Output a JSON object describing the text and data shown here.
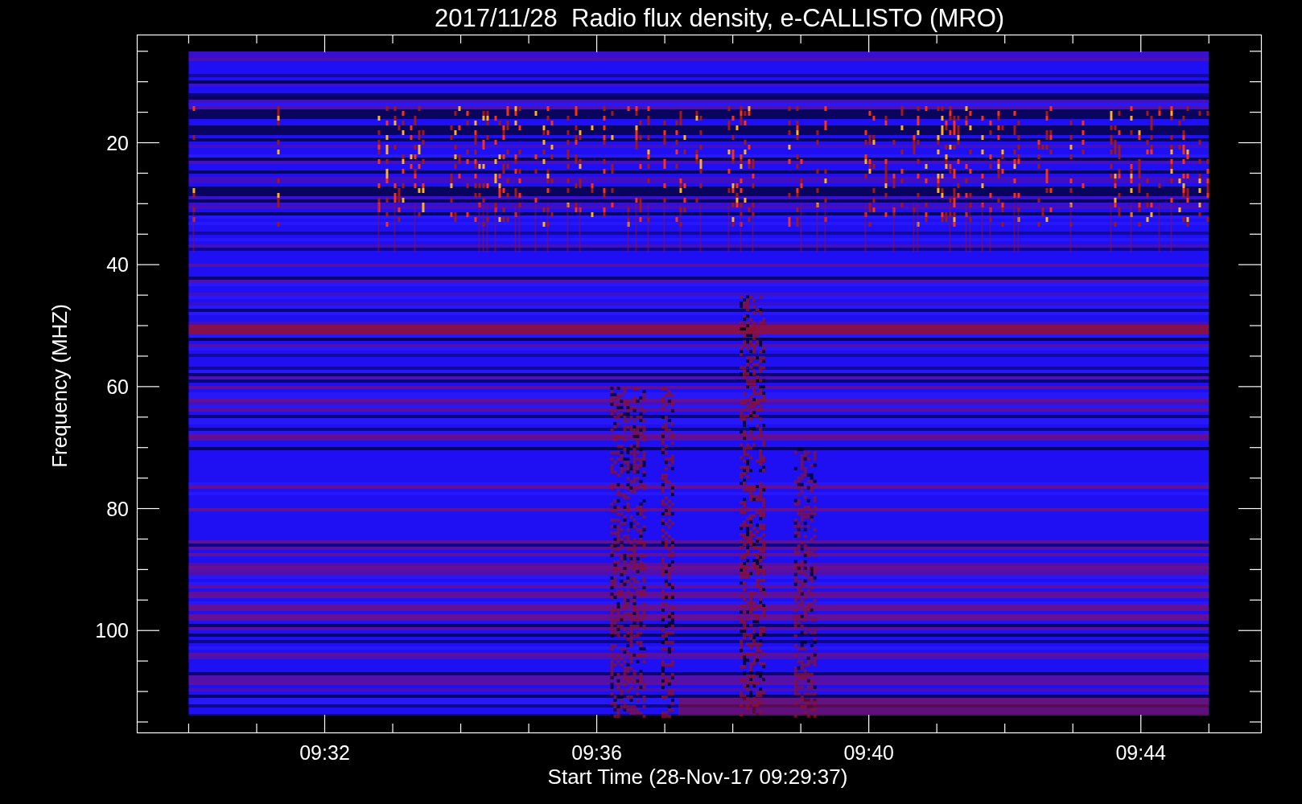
{
  "title": "2017/11/28  Radio flux density, e-CALLISTO (MRO)",
  "y_axis": {
    "label": "Frequency (MHZ)",
    "ticks": [
      "20",
      "40",
      "60",
      "80",
      "100"
    ]
  },
  "x_axis": {
    "label": "Start Time (28-Nov-17 09:29:37)",
    "ticks": [
      "09:32",
      "09:36",
      "09:40",
      "09:44"
    ]
  }
}
